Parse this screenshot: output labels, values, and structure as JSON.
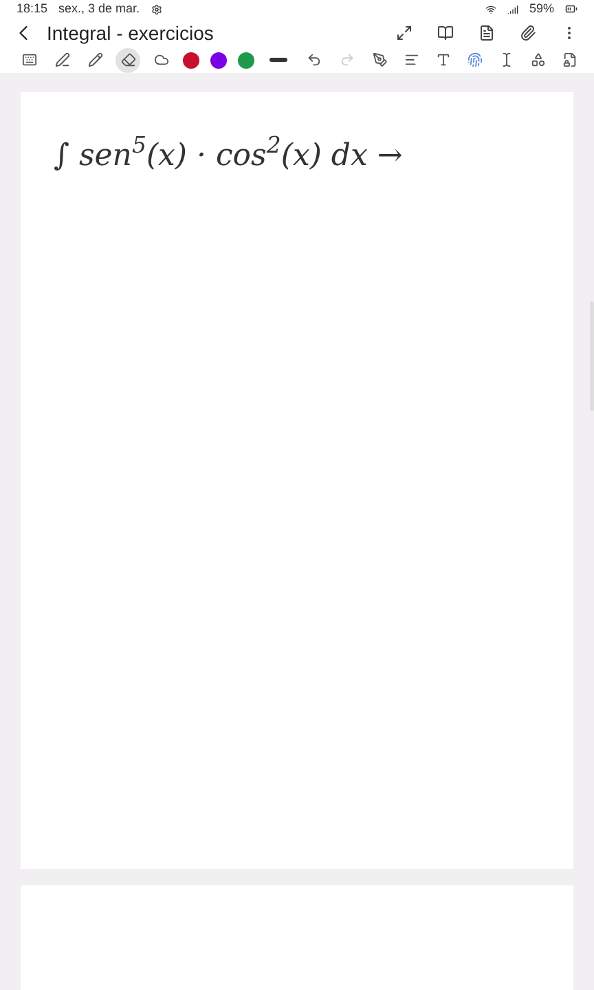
{
  "status_bar": {
    "time": "18:15",
    "date": "sex., 3 de mar.",
    "battery": "59%"
  },
  "header": {
    "title": "Integral - exercicios"
  },
  "toolbar": {
    "tools": [
      {
        "kind": "keyboard",
        "selected": false
      },
      {
        "kind": "pen",
        "selected": false
      },
      {
        "kind": "pencil",
        "selected": false
      },
      {
        "kind": "eraser",
        "selected": true
      },
      {
        "kind": "lasso",
        "selected": false
      }
    ],
    "colors": [
      {
        "color": "#c8102e",
        "selected": false
      },
      {
        "color": "#7a00e6",
        "selected": false
      },
      {
        "color": "#1f9a4a",
        "selected": false
      }
    ],
    "actions": [
      {
        "kind": "undo",
        "disabled": false
      },
      {
        "kind": "redo",
        "disabled": true
      }
    ]
  },
  "pages": [
    {
      "ink": "∫ sen$^{5}$(x) · cos$^{2}$(x) dx →"
    }
  ]
}
